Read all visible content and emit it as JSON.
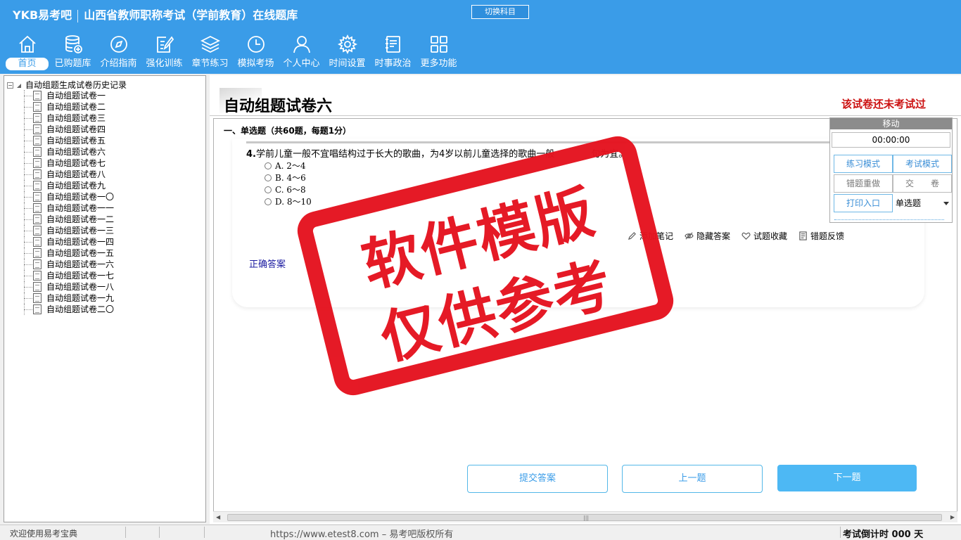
{
  "header": {
    "brand": "YKB易考吧",
    "app_title": "山西省教师职称考试（学前教育）在线题库",
    "switch_subject": "切换科目"
  },
  "toolbar": [
    {
      "label": "首页",
      "icon": "home-icon"
    },
    {
      "label": "已购题库",
      "icon": "database-icon"
    },
    {
      "label": "介绍指南",
      "icon": "compass-icon"
    },
    {
      "label": "强化训练",
      "icon": "edit-icon"
    },
    {
      "label": "章节练习",
      "icon": "layers-icon"
    },
    {
      "label": "模拟考场",
      "icon": "clock-icon"
    },
    {
      "label": "个人中心",
      "icon": "user-icon"
    },
    {
      "label": "时间设置",
      "icon": "gear-icon"
    },
    {
      "label": "时事政治",
      "icon": "notebook-icon"
    },
    {
      "label": "更多功能",
      "icon": "grid-icon"
    }
  ],
  "tree": {
    "root_label": "自动组题生成试卷历史记录",
    "items": [
      "自动组题试卷一",
      "自动组题试卷二",
      "自动组题试卷三",
      "自动组题试卷四",
      "自动组题试卷五",
      "自动组题试卷六",
      "自动组题试卷七",
      "自动组题试卷八",
      "自动组题试卷九",
      "自动组题试卷一〇",
      "自动组题试卷一一",
      "自动组题试卷一二",
      "自动组题试卷一三",
      "自动组题试卷一四",
      "自动组题试卷一五",
      "自动组题试卷一六",
      "自动组题试卷一七",
      "自动组题试卷一八",
      "自动组题试卷一九",
      "自动组题试卷二〇"
    ]
  },
  "main": {
    "paper_title": "自动组题试卷六",
    "exam_status": "该试卷还未考试过",
    "section_title": "一、单选题（共60题，每题1分）",
    "question": {
      "number": "4.",
      "stem": "学前儿童一般不宜唱结构过于长大的歌曲，为4岁以前儿童选择的歌曲一般　　　　句为宜。",
      "options": [
        "A. 2～4",
        "B. 4～6",
        "C. 6～8",
        "D. 8～10"
      ]
    },
    "actions": [
      {
        "label": "添加笔记",
        "icon": "pencil-icon"
      },
      {
        "label": "隐藏答案",
        "icon": "eye-slash-icon"
      },
      {
        "label": "试题收藏",
        "icon": "heart-icon"
      },
      {
        "label": "错题反馈",
        "icon": "feedback-icon"
      }
    ],
    "answer_label": "正确答案",
    "buttons": {
      "submit": "提交答案",
      "prev": "上一题",
      "next": "下一题"
    }
  },
  "float_panel": {
    "move": "移动",
    "timer": "00:00:00",
    "practice_mode": "练习模式",
    "exam_mode": "考试模式",
    "redo_wrong": "错题重做",
    "hand_in": "交　　卷",
    "print": "打印入口",
    "question_type": "单选题"
  },
  "watermark": {
    "line1": "软件模版",
    "line2": "仅供参考"
  },
  "statusbar": {
    "welcome": "欢迎使用易考宝典",
    "copyright": "https://www.etest8.com – 易考吧版权所有",
    "countdown": "考试倒计时 000 天"
  },
  "colors": {
    "header_bg": "#3a9ce8",
    "status_red": "#cc1111",
    "stamp_red": "#e5131f",
    "primary_button": "#4db8f4"
  }
}
